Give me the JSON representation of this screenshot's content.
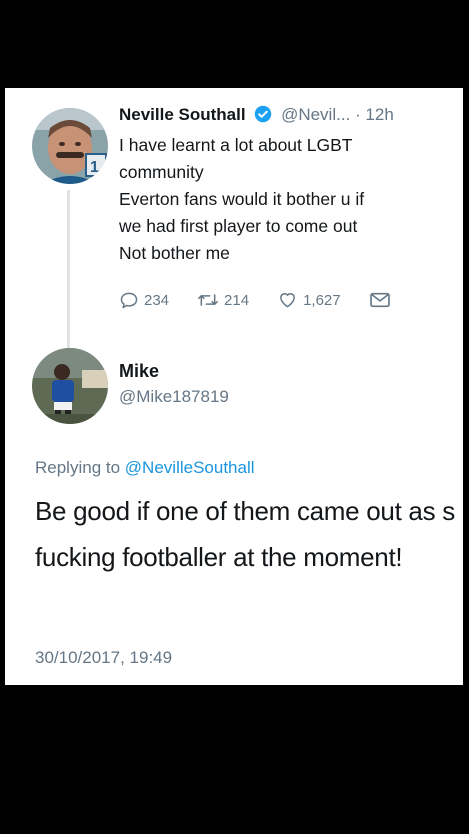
{
  "tweet": {
    "author_name": "Neville Southall",
    "author_handle": "@Nevil...",
    "separator": "·",
    "time_ago": "12h",
    "lines": [
      "I have learnt a lot about LGBT",
      "community",
      "Everton fans would it bother u if",
      "we had first player to come out",
      "Not bother me"
    ],
    "actions": {
      "replies": "234",
      "retweets": "214",
      "likes": "1,627"
    }
  },
  "reply": {
    "author_name": "Mike",
    "author_handle": "@Mike187819",
    "replying_prefix": "Replying to",
    "replying_to": "@NevilleSouthall",
    "text": "Be good if one of them came out as s fucking footballer at the moment!",
    "timestamp": "30/10/2017, 19:49"
  },
  "colors": {
    "background": "#000000",
    "card": "#ffffff",
    "text": "#14171a",
    "secondary": "#657786",
    "link": "#1b95e0",
    "verified": "#1da1f2"
  },
  "icons": [
    "verified-badge-icon",
    "reply-icon",
    "retweet-icon",
    "like-icon",
    "direct-message-icon"
  ]
}
